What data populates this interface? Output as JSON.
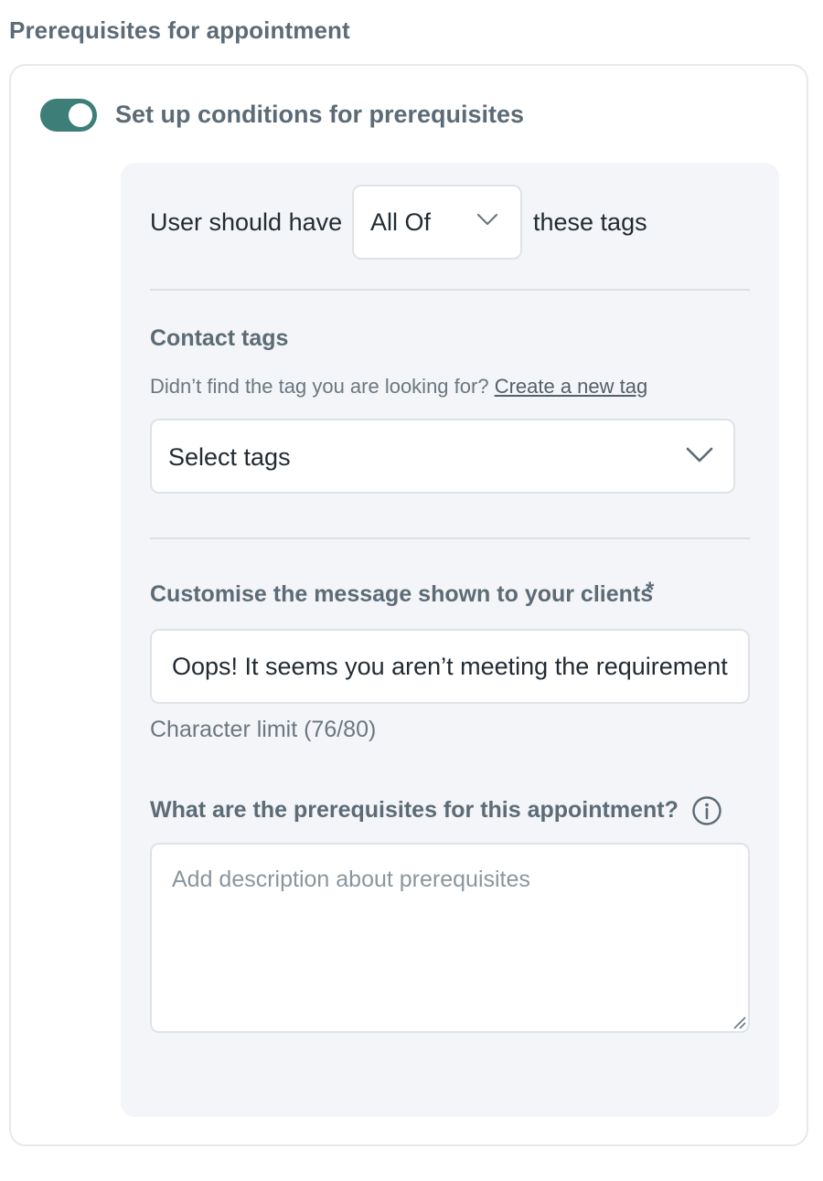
{
  "section": {
    "title": "Prerequisites for appointment"
  },
  "toggle": {
    "label": "Set up conditions for prerequisites",
    "enabled": true,
    "color": "#3d7f78"
  },
  "tag_rule": {
    "prefix": "User should have",
    "selected": "All Of",
    "suffix": "these tags",
    "icon": "chevron-down-icon"
  },
  "contact_tags": {
    "label": "Contact tags",
    "helper_text": "Didn’t find the tag you are looking for?",
    "create_link": "Create a new tag",
    "select_placeholder": "Select tags",
    "icon": "chevron-down-icon"
  },
  "message": {
    "label": "Customise the message shown to your clients",
    "required_mark": "*",
    "value": "Oops! It seems you aren’t meeting the requirements",
    "char_limit": "Character limit (76/80)"
  },
  "prerequisites": {
    "label": "What are the prerequisites for this appointment?",
    "info_icon": "info-icon",
    "placeholder": "Add description about prerequisites"
  }
}
